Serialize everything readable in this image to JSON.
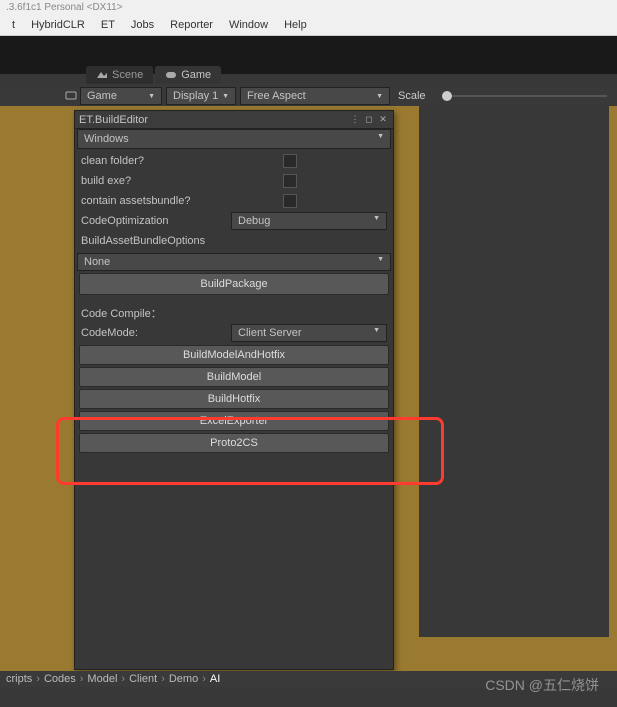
{
  "titlebar": ".3.6f1c1 Personal <DX11>",
  "menubar": [
    "t",
    "HybridCLR",
    "ET",
    "Jobs",
    "Reporter",
    "Window",
    "Help"
  ],
  "tabs": {
    "scene": "Scene",
    "game": "Game"
  },
  "toolstrip": {
    "mode": "Game",
    "display": "Display 1",
    "aspect": "Free Aspect",
    "scale_label": "Scale"
  },
  "panel": {
    "title": "ET.BuildEditor",
    "platform": "Windows",
    "row1": "clean folder?",
    "row2": "build exe?",
    "row3": "contain assetsbundle?",
    "row4_lbl": "CodeOptimization",
    "row4_val": "Debug",
    "row5": "BuildAssetBundleOptions",
    "row5_val": "None",
    "btn_buildpkg": "BuildPackage",
    "compile_header": "Code Compile：",
    "codemode_lbl": "CodeMode:",
    "codemode_val": "Client Server",
    "btn_mh": "BuildModelAndHotfix",
    "btn_m": "BuildModel",
    "btn_h": "BuildHotfix",
    "btn_ex": "ExcelExporter",
    "btn_p2cs": "Proto2CS"
  },
  "breadcrumb": [
    "cripts",
    "Codes",
    "Model",
    "Client",
    "Demo",
    "AI"
  ],
  "watermark": "CSDN @五仁烧饼"
}
